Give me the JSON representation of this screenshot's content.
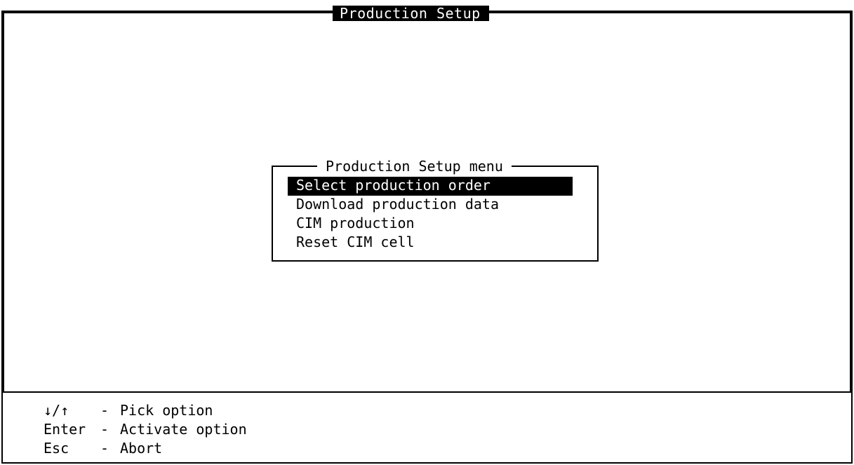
{
  "window": {
    "title": "Production Setup"
  },
  "menu": {
    "title": "Production Setup menu",
    "items": [
      {
        "label": "Select production order",
        "selected": true
      },
      {
        "label": "Download production data",
        "selected": false
      },
      {
        "label": "CIM production",
        "selected": false
      },
      {
        "label": "Reset CIM cell",
        "selected": false
      }
    ]
  },
  "help": {
    "lines": [
      {
        "key": "↓/↑",
        "sep": "-",
        "text": "Pick option"
      },
      {
        "key": "Enter",
        "sep": "-",
        "text": "Activate option"
      },
      {
        "key": "Esc",
        "sep": "-",
        "text": "Abort"
      }
    ]
  },
  "colors": {
    "background": "#ffffff",
    "foreground": "#000000",
    "highlight_bg": "#000000",
    "highlight_fg": "#ffffff"
  }
}
